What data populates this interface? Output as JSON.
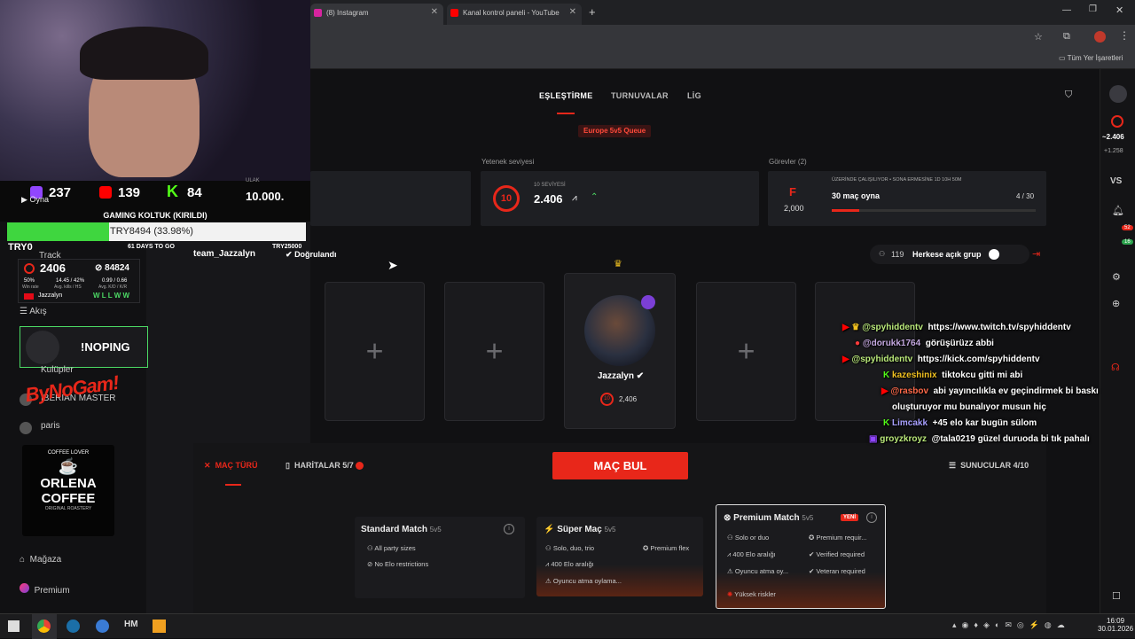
{
  "browser": {
    "tabs": [
      {
        "label": "(8) Instagram",
        "color": "#d6249f"
      },
      {
        "label": "Kanal kontrol paneli - YouTube",
        "color": "#ff0000"
      }
    ],
    "new_tab": "+",
    "bookmarks_label": "Tüm Yer İşaretleri"
  },
  "app": {
    "nav": [
      "EŞLEŞTİRME",
      "TURNUVALAR",
      "LİG"
    ],
    "queue_badge": "Europe 5v5 Queue",
    "skill": {
      "title": "Yetenek seviyesi",
      "level_label": "10 SEVİYESİ",
      "level": "10",
      "elo": "2.406"
    },
    "missions": {
      "title": "Görevler (2)",
      "letter": "F",
      "points": "2,000",
      "sub": "ÜZERİNDE ÇALIŞILIYOR • SONA ERMESİNE 1D 10H 50M",
      "task": "30 maç oyna",
      "progress_text": "4 / 30",
      "progress": 0.1333
    },
    "party": {
      "count": "119",
      "label": "Herkese açık grup"
    },
    "player": {
      "name": "Jazzalyn",
      "elo": "2,406",
      "level": "10"
    },
    "bottom": {
      "match_type": "MAÇ TÜRÜ",
      "maps": "HARİTALAR 5/7",
      "find_match": "MAÇ BUL",
      "servers": "SUNUCULAR 4/10"
    },
    "cards": [
      {
        "title": "Standard Match",
        "mode": "5v5",
        "lines": [
          "All party sizes",
          "No Elo restrictions"
        ]
      },
      {
        "title": "Süper Maç",
        "mode": "5v5",
        "lines": [
          "Solo, duo, trio",
          "400 Elo aralığı",
          "Oyuncu atma oylama..."
        ],
        "right": "Premium flex"
      },
      {
        "title": "Premium Match",
        "mode": "5v5",
        "badge": "YENİ",
        "lines": [
          "Solo or duo",
          "400 Elo aralığı",
          "Oyuncu atma oy..."
        ],
        "right": [
          "Premium requir...",
          "Verified required",
          "Veteran required"
        ],
        "footer": "Yüksek riskler"
      }
    ]
  },
  "left_nav": {
    "play": "Oyna",
    "track": "Track",
    "feed": "Akış",
    "clubs": "Kulüpler",
    "store": "Mağaza",
    "premium": "Premium",
    "user": "team_Jazzalyn",
    "verified": "Doğrulandı"
  },
  "overlay": {
    "twitch": "237",
    "youtube": "139",
    "kick": "84",
    "ulak_label": "ULAK",
    "ulak": "10.000.",
    "goal_title": "GAMING KOLTUK (KIRILDI)",
    "goal_text": "TRY8494 (33.98%)",
    "goal_fill": 0.3398,
    "goal_left": "TRY0",
    "goal_mid": "61 DAYS TO GO",
    "goal_right": "TRY25000",
    "stats": {
      "elo": "2406",
      "matches": "84824",
      "winrate": "50%",
      "winrate_label": "Win rate",
      "kills": "14.45 / 42%",
      "kills_label": "Avg. kills / HS",
      "kd": "0.99 / 0.66",
      "kd_label": "Avg. K/D / K/R",
      "name": "Jazzalyn",
      "results": "W L L W W"
    },
    "noping": "!NOPING",
    "iberian": "IBERIAN MASTER",
    "paris": "paris",
    "coffee": [
      "COFFEE LOVER",
      "ORLENA",
      "COFFEE",
      "ORIGINAL ROASTERY"
    ]
  },
  "right_rail": {
    "elo": "~2.406",
    "change": "+1.258",
    "vs": "VS",
    "badge1": "52",
    "badge2": "16"
  },
  "chat": [
    {
      "user": "@spyhiddentv",
      "msg": "https://www.twitch.tv/spyhiddentv"
    },
    {
      "user": "@dorukk1764",
      "msg": "görüşürüzz abbi"
    },
    {
      "user": "@spyhiddentv",
      "msg": "https://kick.com/spyhiddentv"
    },
    {
      "user": "kazeshinix",
      "msg": "tiktokcu gitti mi abi"
    },
    {
      "user": "@rasbov",
      "msg": "abi yayıncılıkla ev geçindirmek bi baskı"
    },
    {
      "user": "",
      "msg": "oluşturuyor mu bunalıyor musun hiç"
    },
    {
      "user": "Limcakk",
      "msg": "+45 elo kar bugün sülom"
    },
    {
      "user": "groyzkroyz",
      "msg": "@tala0219 güzel duruoda bi tık pahalı"
    }
  ],
  "taskbar": {
    "time": "16:09",
    "date": "30.01.2026"
  },
  "colors": {
    "accent": "#e8271a",
    "green": "#4cd964",
    "goal": "#3fd63f"
  }
}
